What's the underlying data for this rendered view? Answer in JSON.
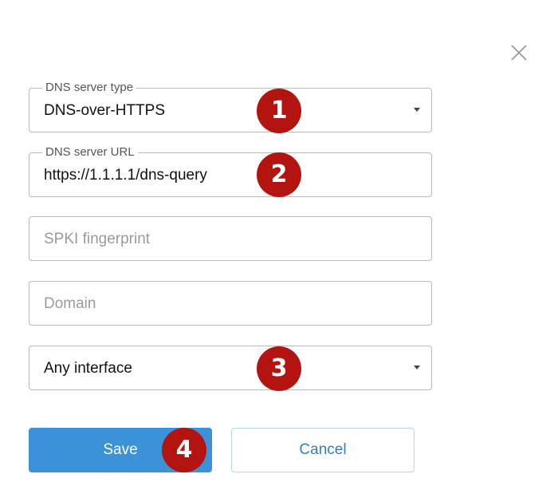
{
  "dialog": {
    "close_icon": "close-icon"
  },
  "form": {
    "dns_server_type": {
      "label": "DNS server type",
      "value": "DNS-over-HTTPS"
    },
    "dns_server_url": {
      "label": "DNS server URL",
      "value": "https://1.1.1.1/dns-query"
    },
    "spki_fingerprint": {
      "placeholder": "SPKI fingerprint",
      "value": ""
    },
    "domain": {
      "placeholder": "Domain",
      "value": ""
    },
    "interface": {
      "value": "Any interface"
    }
  },
  "actions": {
    "save_label": "Save",
    "cancel_label": "Cancel"
  },
  "markers": [
    "1",
    "2",
    "3",
    "4"
  ],
  "colors": {
    "marker": "#b3140f",
    "primary": "#3c92d8",
    "cancel_text": "#2f80c9",
    "border": "#b9b9b9"
  }
}
